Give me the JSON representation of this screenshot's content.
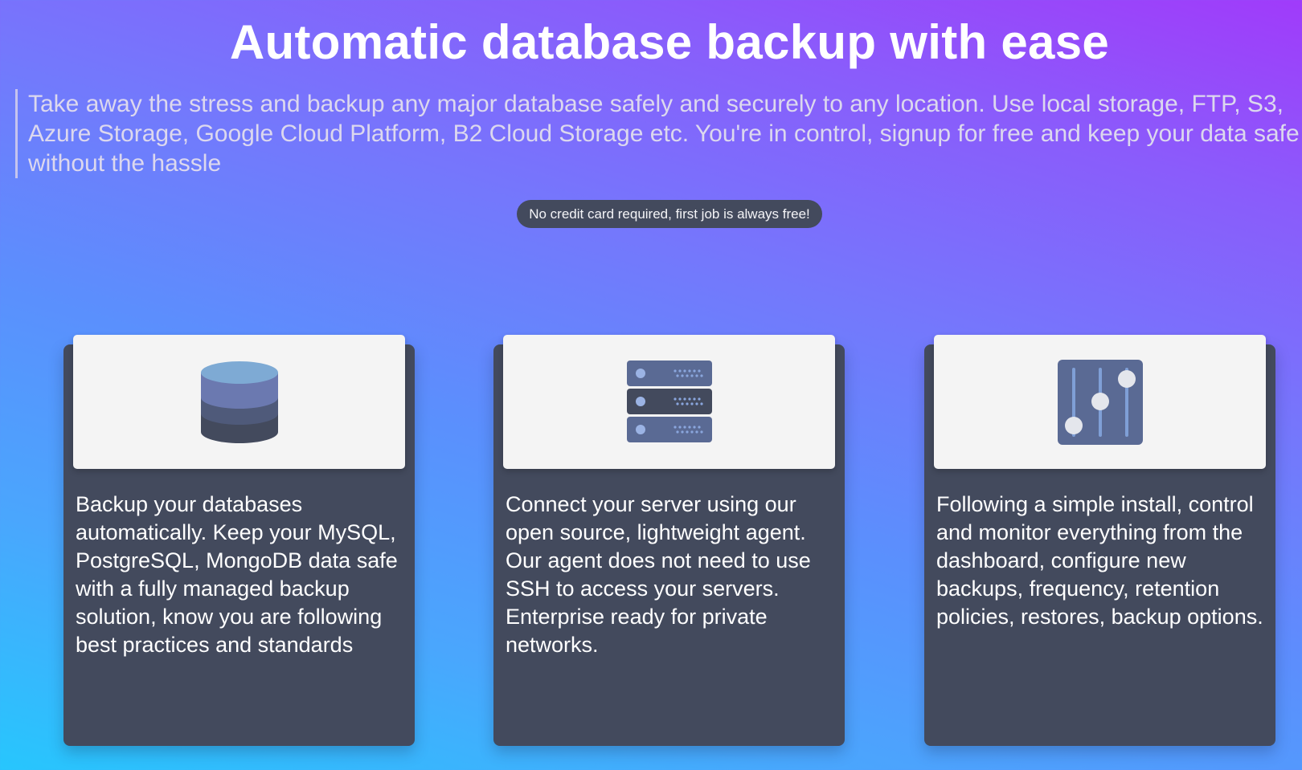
{
  "hero": {
    "title": "Automatic database backup with ease",
    "description": "Take away the stress and backup any major database safely and securely to any location. Use local storage, FTP, S3, Azure Storage, Google Cloud Platform, B2 Cloud Storage etc. You're in control, signup for free and keep your data safe without the hassle",
    "badge": "No credit card required, first job is always free!"
  },
  "features": [
    {
      "icon": "database-icon",
      "text": "Backup your databases automatically. Keep your MySQL, PostgreSQL, MongoDB data safe with a fully managed backup solution, know you are following best practices and standards"
    },
    {
      "icon": "server-icon",
      "text": "Connect your server using our open source, lightweight agent. Our agent does not need to use SSH to access your servers. Enterprise ready for private networks."
    },
    {
      "icon": "sliders-icon",
      "text": "Following a simple install, control and monitor everything from the dashboard, configure new backups, frequency, retention policies, restores, backup options."
    }
  ],
  "colors": {
    "gradient_start": "#27c6fd",
    "gradient_end": "#a03bfa",
    "card_background": "#434a5d",
    "card_image_background": "#f4f4f4",
    "icon_dark": "#434a5d",
    "icon_mid": "#5a6a94",
    "icon_light": "#7f9fd6"
  }
}
